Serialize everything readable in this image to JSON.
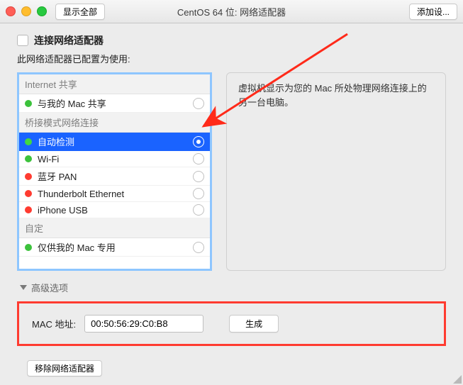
{
  "titlebar": {
    "show_all": "显示全部",
    "title": "CentOS 64 位: 网络适配器",
    "add_device": "添加设..."
  },
  "connect": {
    "checkbox_label": "连接网络适配器",
    "desc": "此网络适配器已配置为使用:"
  },
  "sections": {
    "internet_sharing": "Internet 共享",
    "bridged": "桥接模式网络连接",
    "custom": "自定"
  },
  "options": {
    "share_mac": "与我的 Mac 共享",
    "auto_detect": "自动检测",
    "wifi": "Wi-Fi",
    "bt_pan": "蓝牙 PAN",
    "thunderbolt": "Thunderbolt Ethernet",
    "iphone_usb": "iPhone USB",
    "mac_only": "仅供我的 Mac 专用"
  },
  "colors": {
    "green": "#3cc23c",
    "red": "#ff3b30",
    "selected_green": "#42d742"
  },
  "right_desc": "虚拟机显示为您的 Mac 所处物理网络连接上的另一台电脑。",
  "advanced_label": "高级选项",
  "mac": {
    "label": "MAC 地址:",
    "value": "00:50:56:29:C0:B8",
    "generate": "生成"
  },
  "remove_label": "移除网络适配器"
}
